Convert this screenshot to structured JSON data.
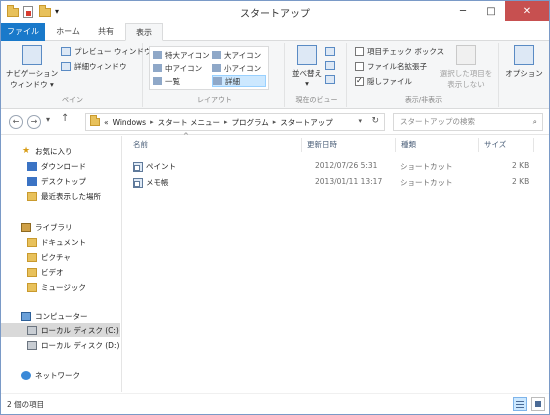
{
  "window": {
    "title": "スタートアップ",
    "minimize": "─",
    "maximize": "□",
    "close": "✕"
  },
  "tabs": [
    {
      "label": "ファイル"
    },
    {
      "label": "ホーム"
    },
    {
      "label": "共有"
    },
    {
      "label": "表示"
    }
  ],
  "ribbon": {
    "pane_group": {
      "nav_pane_line1": "ナビゲーション",
      "nav_pane_line2": "ウィンドウ ▾",
      "preview": "プレビュー ウィンドウ",
      "details": "詳細ウィンドウ",
      "label": "ペイン"
    },
    "layout_group": {
      "items": [
        "特大アイコン",
        "大アイコン",
        "中アイコン",
        "小アイコン",
        "一覧",
        "詳細"
      ],
      "selected": "詳細",
      "label": "レイアウト"
    },
    "current_view_group": {
      "sort": "並べ替え",
      "sort_arrow": "▾",
      "label": "現在のビュー"
    },
    "show_hide_group": {
      "item_checkbox": "項目チェック ボックス",
      "file_ext": "ファイル名拡張子",
      "hidden_files": "隠しファイル",
      "hide_selected_line1": "選択した項目を",
      "hide_selected_line2": "表示しない",
      "label": "表示/非表示"
    },
    "options": "オプション",
    "hidden_files_checked": true,
    "item_checkbox_checked": false,
    "file_ext_checked": false
  },
  "nav": {
    "back": "←",
    "forward": "→",
    "recent": "▾",
    "up": "↑",
    "breadcrumb": [
      "«",
      "Windows",
      "スタート メニュー",
      "プログラム",
      "スタートアップ"
    ],
    "breadcrumb_sep": "▸",
    "dropdown": "▾",
    "refresh": "↻",
    "search_placeholder": "スタートアップの検索",
    "search_icon": "⌕"
  },
  "sidebar": {
    "favorites": {
      "label": "お気に入り",
      "items": [
        "ダウンロード",
        "デスクトップ",
        "最近表示した場所"
      ]
    },
    "libraries": {
      "label": "ライブラリ",
      "items": [
        "ドキュメント",
        "ピクチャ",
        "ビデオ",
        "ミュージック"
      ]
    },
    "computer": {
      "label": "コンピューター",
      "items": [
        "ローカル ディスク (C:)",
        "ローカル ディスク (D:)"
      ]
    },
    "network": {
      "label": "ネットワーク"
    }
  },
  "filelist": {
    "columns": [
      "名前",
      "更新日時",
      "種類",
      "サイズ"
    ],
    "sort_indicator": "^",
    "rows": [
      {
        "name": "ペイント",
        "modified": "2012/07/26 5:31",
        "type": "ショートカット",
        "size": "2 KB"
      },
      {
        "name": "メモ帳",
        "modified": "2013/01/11 13:17",
        "type": "ショートカット",
        "size": "2 KB"
      }
    ]
  },
  "status": {
    "text": "2 個の項目"
  }
}
